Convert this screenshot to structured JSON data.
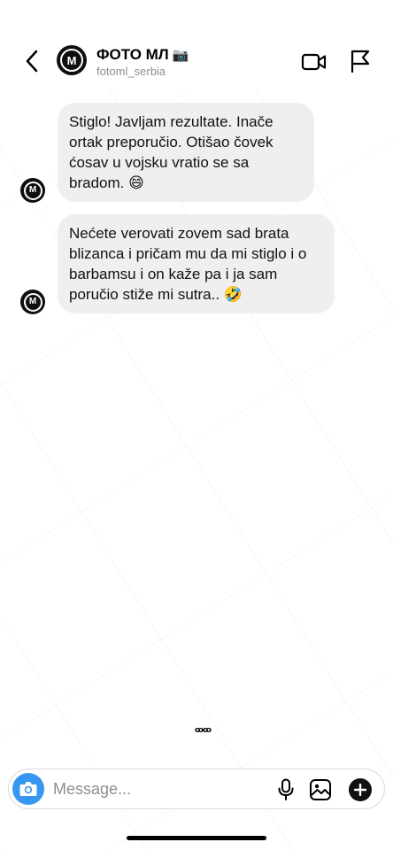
{
  "header": {
    "title": "ФОТО МЛ",
    "title_emoji": "📷",
    "username": "fotoml_serbia",
    "avatar_letter": "M"
  },
  "messages": [
    {
      "text": "Stiglo! Javljam rezultate. Inače ortak preporučio. Otišao čovek ćosav u vojsku vratio se sa bradom. 😄"
    },
    {
      "text": "Nećete verovati zovem sad brata blizanca i pričam mu da mi stiglo i o barbamsu i on kaže pa i ja sam poručio stiže mi sutra.. 🤣"
    }
  ],
  "seen_indicator": "ꝏꝏ",
  "composer": {
    "placeholder": "Message...",
    "value": ""
  },
  "colors": {
    "accent_blue": "#3797f0",
    "bubble_gray": "#efefef",
    "secondary_text": "#8e8e8e"
  }
}
